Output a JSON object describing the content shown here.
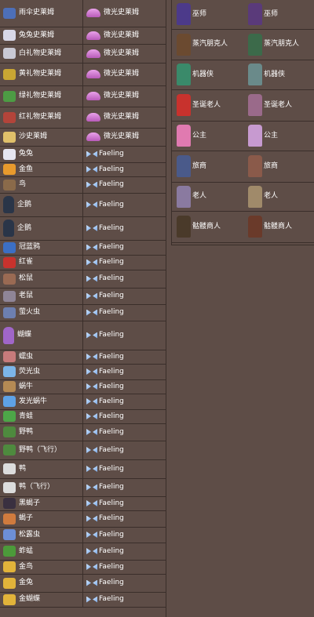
{
  "left_rows": [
    {
      "name": "雨伞史莱姆",
      "variant": "微光史莱姆",
      "h": 34,
      "icon": "umbrella-slime",
      "color": "#4d6fb8",
      "slime": true
    },
    {
      "name": "兔兔史莱姆",
      "variant": "微光史莱姆",
      "h": 22,
      "icon": "bunny-slime",
      "color": "#d8d8e8",
      "slime": true
    },
    {
      "name": "白礼物史莱姆",
      "variant": "微光史莱姆",
      "h": 24,
      "icon": "white-present-slime",
      "color": "#c9c9d4",
      "slime": true
    },
    {
      "name": "黄礼物史莱姆",
      "variant": "微光史莱姆",
      "h": 29,
      "icon": "yellow-present-slime",
      "color": "#c9a633",
      "slime": true
    },
    {
      "name": "绿礼物史莱姆",
      "variant": "微光史莱姆",
      "h": 27,
      "icon": "green-present-slime",
      "color": "#4d9c44",
      "slime": true
    },
    {
      "name": "红礼物史莱姆",
      "variant": "微光史莱姆",
      "h": 27,
      "icon": "red-present-slime",
      "color": "#b3443a",
      "slime": true
    },
    {
      "name": "沙史莱姆",
      "variant": "微光史莱姆",
      "h": 23,
      "icon": "sand-slime",
      "color": "#e0c06a",
      "slime": true
    },
    {
      "name": "兔兔",
      "variant": "Faeling",
      "h": 21,
      "icon": "bunny",
      "color": "#e6e6f0"
    },
    {
      "name": "金鱼",
      "variant": "Faeling",
      "h": 18,
      "icon": "goldfish",
      "color": "#e89a2d"
    },
    {
      "name": "鸟",
      "variant": "Faeling",
      "h": 21,
      "icon": "bird",
      "color": "#8a6a4a"
    },
    {
      "name": "企鹅",
      "variant": "Faeling",
      "h": 30,
      "icon": "penguin",
      "color": "#2a3548",
      "tall": true
    },
    {
      "name": "企鹅",
      "variant": "Faeling",
      "h": 30,
      "icon": "penguin",
      "color": "#2a3548",
      "tall": true
    },
    {
      "name": "冠蓝鸦",
      "variant": "Faeling",
      "h": 19,
      "icon": "blue-jay",
      "color": "#3c6fc4"
    },
    {
      "name": "红雀",
      "variant": "Faeling",
      "h": 19,
      "icon": "cardinal",
      "color": "#c8322d"
    },
    {
      "name": "松鼠",
      "variant": "Faeling",
      "h": 23,
      "icon": "squirrel",
      "color": "#9a6a53"
    },
    {
      "name": "老鼠",
      "variant": "Faeling",
      "h": 21,
      "icon": "mouse",
      "color": "#8f8597"
    },
    {
      "name": "萤火虫",
      "variant": "Faeling",
      "h": 21,
      "icon": "firefly",
      "color": "#6d7fb0"
    },
    {
      "name": "蝴蝶",
      "variant": "Faeling",
      "h": 37,
      "icon": "butterfly",
      "color": "#a066c8",
      "tall": true
    },
    {
      "name": "蠕虫",
      "variant": "Faeling",
      "h": 18,
      "icon": "worm",
      "color": "#c77b7b"
    },
    {
      "name": "荧光虫",
      "variant": "Faeling",
      "h": 20,
      "icon": "lightning-bug",
      "color": "#7cb5e8"
    },
    {
      "name": "蜗牛",
      "variant": "Faeling",
      "h": 18,
      "icon": "snail",
      "color": "#b58a54"
    },
    {
      "name": "发光蜗牛",
      "variant": "Faeling",
      "h": 20,
      "icon": "glowing-snail",
      "color": "#5ea2e6"
    },
    {
      "name": "青蛙",
      "variant": "Faeling",
      "h": 18,
      "icon": "frog",
      "color": "#4da648"
    },
    {
      "name": "野鸭",
      "variant": "Faeling",
      "h": 22,
      "icon": "mallard-duck",
      "color": "#4e8a3e"
    },
    {
      "name": "野鸭（飞行）",
      "variant": "Faeling",
      "h": 24,
      "icon": "mallard-duck-flying",
      "color": "#4e8a3e"
    },
    {
      "name": "鸭",
      "variant": "Faeling",
      "h": 24,
      "icon": "duck",
      "color": "#dcdcdc"
    },
    {
      "name": "鸭（飞行）",
      "variant": "Faeling",
      "h": 23,
      "icon": "duck-flying",
      "color": "#dcdcdc"
    },
    {
      "name": "黑蝎子",
      "variant": "Faeling",
      "h": 18,
      "icon": "black-scorpion",
      "color": "#3a3040"
    },
    {
      "name": "蝎子",
      "variant": "Faeling",
      "h": 21,
      "icon": "scorpion",
      "color": "#d07b3e"
    },
    {
      "name": "松露虫",
      "variant": "Faeling",
      "h": 20,
      "icon": "truffle-worm",
      "color": "#6d8fd6"
    },
    {
      "name": "蚱蜢",
      "variant": "Faeling",
      "h": 22,
      "icon": "grasshopper",
      "color": "#4c9a3a"
    },
    {
      "name": "金鸟",
      "variant": "Faeling",
      "h": 18,
      "icon": "gold-bird",
      "color": "#e2b33a"
    },
    {
      "name": "金兔",
      "variant": "Faeling",
      "h": 23,
      "icon": "gold-bunny",
      "color": "#e2b33a"
    },
    {
      "name": "金蝴蝶",
      "variant": "Faeling",
      "h": 19,
      "icon": "gold-butterfly",
      "color": "#e2b33a"
    }
  ],
  "right_rows": [
    {
      "a": "巫师",
      "b": "巫师",
      "h": 37,
      "ca": "#4c3a8a",
      "cb": "#5a3a7a"
    },
    {
      "a": "蒸汽朋克人",
      "b": "蒸汽朋克人",
      "h": 39,
      "ca": "#6b4a30",
      "cb": "#3c6a4a"
    },
    {
      "a": "机器侠",
      "b": "机器侠",
      "h": 38,
      "ca": "#3a8a6a",
      "cb": "#6a8a8a"
    },
    {
      "a": "圣诞老人",
      "b": "圣诞老人",
      "h": 40,
      "ca": "#c8322d",
      "cb": "#9a6a8a"
    },
    {
      "a": "公主",
      "b": "公主",
      "h": 38,
      "ca": "#e07ab0",
      "cb": "#c79ad0"
    },
    {
      "a": "旅商",
      "b": "旅商",
      "h": 40,
      "ca": "#4a5a8a",
      "cb": "#8a5a4a"
    },
    {
      "a": "老人",
      "b": "老人",
      "h": 37,
      "ca": "#8a7aa0",
      "cb": "#a08a6a"
    },
    {
      "a": "骷髅商人",
      "b": "骷髅商人",
      "h": 40,
      "ca": "#4a3a2a",
      "cb": "#6a3a2a"
    }
  ]
}
